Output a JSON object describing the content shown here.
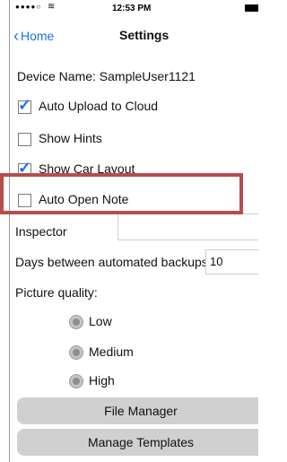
{
  "status_bar": {
    "signal": "●●●●○",
    "wifi": "wifi-icon",
    "time": "12:53 PM"
  },
  "nav": {
    "back_label": "Home",
    "title": "Settings"
  },
  "settings": {
    "device_name": "Device Name: SampleUser1121",
    "auto_upload": {
      "label": "Auto Upload to Cloud",
      "checked": true
    },
    "show_hints": {
      "label": "Show Hints",
      "checked": false
    },
    "show_car_layout": {
      "label": "Show Car Layout",
      "checked": true
    },
    "auto_open_note": {
      "label": "Auto Open Note",
      "checked": false
    },
    "inspector": {
      "label": "Inspector",
      "value": ""
    },
    "backups": {
      "label": "Days between automated backups",
      "value": "10"
    },
    "picture_quality": {
      "label": "Picture quality:",
      "options": [
        "Low",
        "Medium",
        "High"
      ]
    }
  },
  "buttons": {
    "file_manager": "File Manager",
    "manage_templates": "Manage Templates"
  },
  "colors": {
    "accent": "#1a73e8",
    "highlight": "#b84d4d",
    "button_bg": "#d0d0d0"
  }
}
